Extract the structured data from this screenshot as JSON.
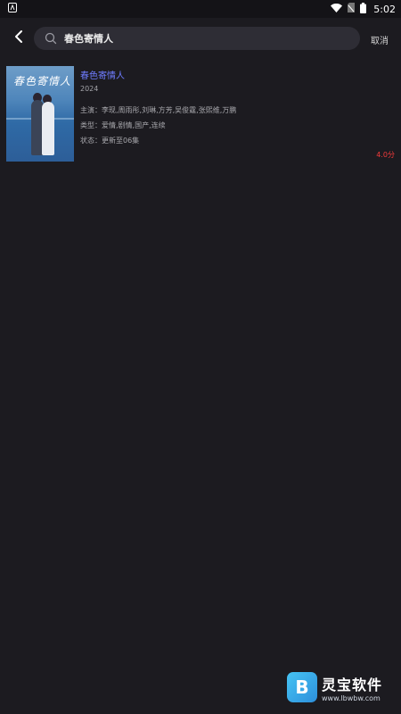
{
  "status_bar": {
    "time": "5:02",
    "icons": [
      "app-icon",
      "wifi-icon",
      "sim-icon",
      "battery-icon"
    ]
  },
  "search": {
    "value": "春色寄情人",
    "placeholder": "",
    "cancel_label": "取消"
  },
  "result": {
    "poster_title": "春色寄情人",
    "title": "春色寄情人",
    "year": "2024",
    "cast_label": "主演：",
    "cast": "李现,周雨彤,刘琳,方芳,吴俊霆,张熙维,万鹏",
    "genre_label": "类型：",
    "genre": "爱情,剧情,国产,连续",
    "status_label": "状态：",
    "status": "更新至06集",
    "score": "4.0分"
  },
  "watermark": {
    "name": "灵宝软件",
    "url": "www.lbwbw.com"
  },
  "colors": {
    "background": "#1c1b20",
    "title_accent": "#6f7cff",
    "score": "#f13a3a"
  }
}
